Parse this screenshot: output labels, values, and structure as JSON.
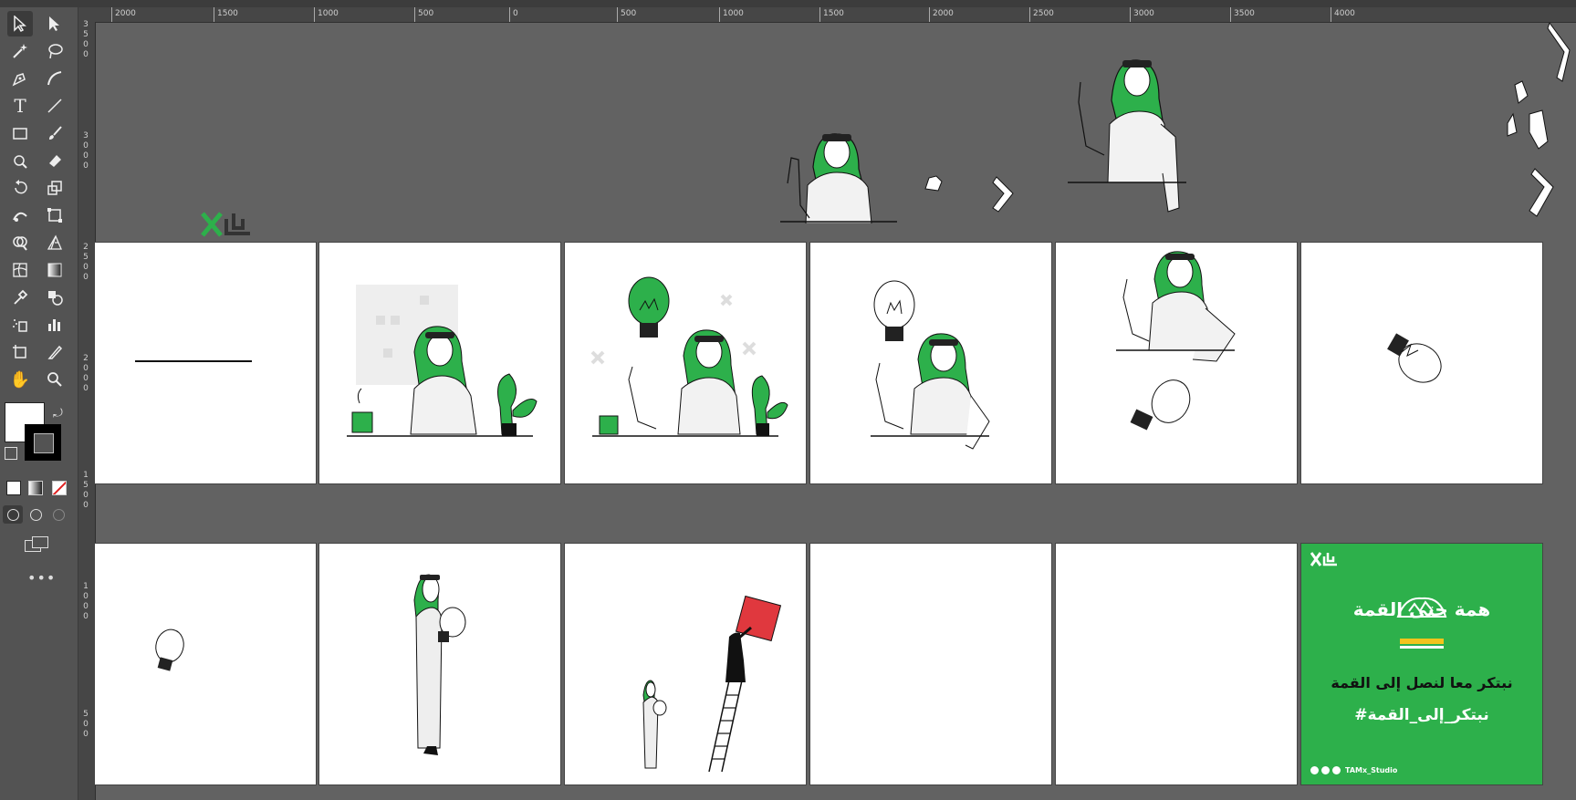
{
  "ruler": {
    "h_ticks": [
      "2000",
      "1500",
      "1000",
      "500",
      "0",
      "500",
      "1000",
      "1500",
      "2000",
      "2500",
      "3000",
      "3500",
      "4000"
    ],
    "v_ticks": [
      [
        "3",
        "5",
        "0",
        "0"
      ],
      [
        "3",
        "0",
        "0",
        "0"
      ],
      [
        "2",
        "5",
        "0",
        "0"
      ],
      [
        "2",
        "0",
        "0",
        "0"
      ],
      [
        "1",
        "5",
        "0",
        "0"
      ],
      [
        "1",
        "0",
        "0",
        "0"
      ],
      [
        "5",
        "0",
        "0"
      ]
    ]
  },
  "poster": {
    "logo_text": "همة حتى القمة",
    "headline": "نبتكر معا لنصل إلى القمة",
    "hashtag": "#نبتكر_إلى_القمة",
    "handle": "TAMx_Studio",
    "color": "#2db04b"
  },
  "colors": {
    "green": "#2db04b",
    "red": "#e0383e",
    "canvas": "#626262",
    "ui": "#535353"
  },
  "tools": [
    "selection",
    "direct-selection",
    "magic-wand",
    "lasso",
    "pen",
    "curvature",
    "type",
    "line",
    "rectangle",
    "paintbrush",
    "shaper",
    "eraser",
    "rotate",
    "scale",
    "warp",
    "free-transform",
    "shape-builder",
    "perspective",
    "mesh",
    "gradient",
    "eyedropper",
    "blend",
    "symbol-sprayer",
    "column-graph",
    "artboard",
    "slice",
    "hand",
    "zoom"
  ]
}
